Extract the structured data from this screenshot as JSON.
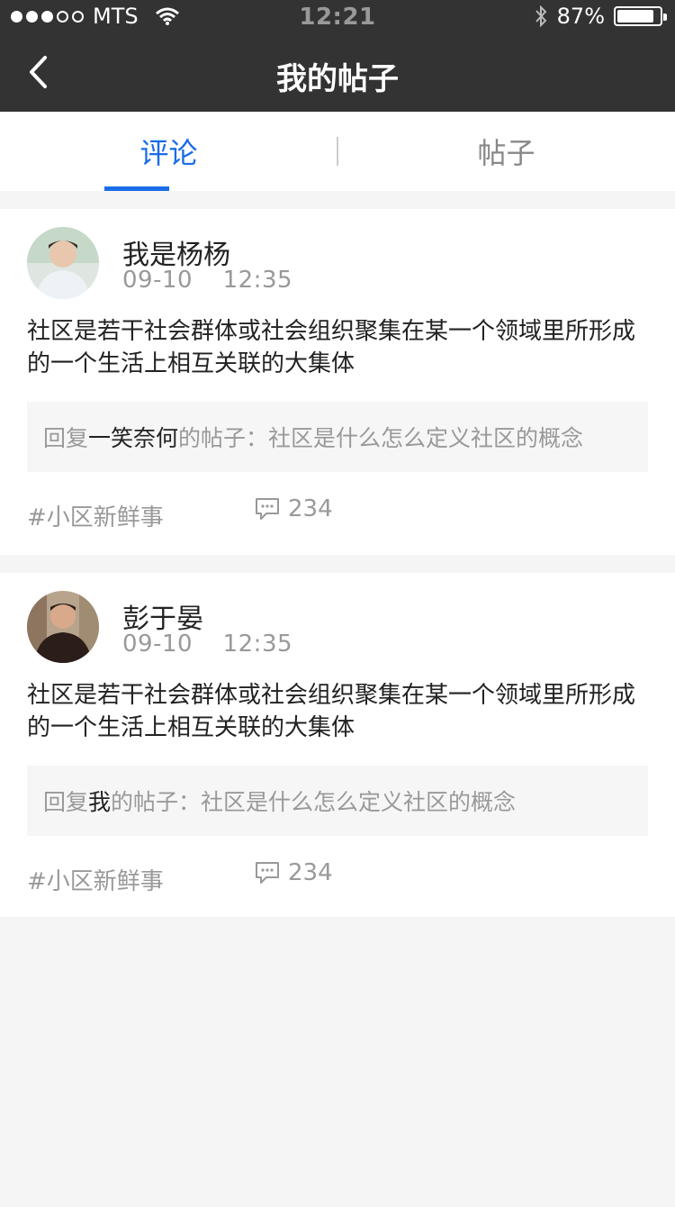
{
  "status_bar": {
    "carrier": "MTS",
    "time": "12:21",
    "battery": "87%",
    "battery_level": 0.87
  },
  "nav": {
    "title": "我的帖子",
    "back_icon": "chevron-left-icon"
  },
  "tabs": [
    {
      "label": "评论",
      "active": true
    },
    {
      "label": "帖子",
      "active": false
    }
  ],
  "posts": [
    {
      "user": "我是杨杨",
      "date": "09-10",
      "time": "12:35",
      "content": "社区是若干社会群体或社会组织聚集在某一个领域里所形成的一个生活上相互关联的大集体",
      "reply_prefix": "回复",
      "reply_user": "一笑奈何",
      "reply_suffix": "的帖子：社区是什么怎么定义社区的概念",
      "tag": "#小区新鲜事",
      "comment_count": "234"
    },
    {
      "user": "彭于晏",
      "date": "09-10",
      "time": "12:35",
      "content": "社区是若干社会群体或社会组织聚集在某一个领域里所形成的一个生活上相互关联的大集体",
      "reply_prefix": "回复",
      "reply_user": "我",
      "reply_suffix": "的帖子：社区是什么怎么定义社区的概念",
      "tag": "#小区新鲜事",
      "comment_count": "234"
    }
  ],
  "colors": {
    "accent": "#1a6ce8",
    "topbar": "#333333",
    "background": "#f5f5f5"
  }
}
